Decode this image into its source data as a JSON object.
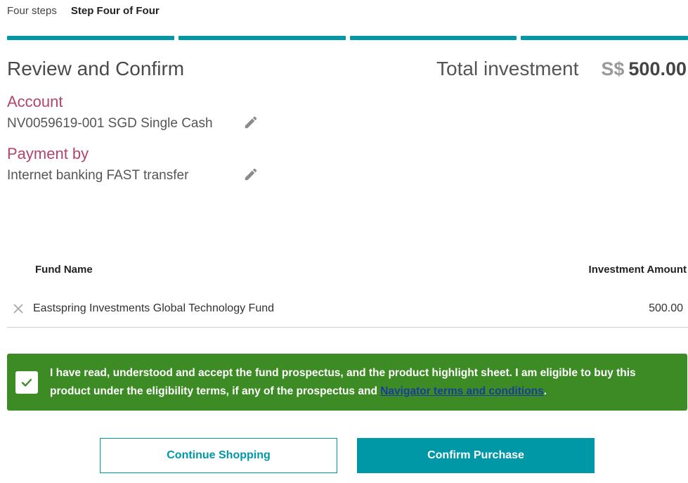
{
  "colors": {
    "accent": "#0097a7",
    "section_label": "#b0456e",
    "consent_bg": "#3d8b25",
    "link": "#1a3c9a"
  },
  "steps": {
    "label": "Four steps",
    "current": "Step Four of Four",
    "total_steps": 4,
    "completed_steps": 4
  },
  "review": {
    "title": "Review and Confirm",
    "total_label": "Total investment",
    "currency": "S$",
    "total_amount": "500.00"
  },
  "account": {
    "label": "Account",
    "value": "NV0059619-001 SGD Single Cash",
    "edit_icon": "pencil-icon"
  },
  "payment": {
    "label": "Payment by",
    "value": "Internet banking FAST transfer",
    "edit_icon": "pencil-icon"
  },
  "table": {
    "col_fund_name": "Fund Name",
    "col_investment_amount": "Investment Amount",
    "rows": [
      {
        "fund_name": "Eastspring Investments Global Technology Fund",
        "amount": "500.00",
        "remove_icon": "close-icon"
      }
    ]
  },
  "consent": {
    "checked": true,
    "text_before": "I have read, understood and accept the fund prospectus, and the product highlight sheet. I am eligible to buy this product under the eligibility terms, if any of the prospectus and ",
    "link_text": "Navigator terms and conditions",
    "text_after": "."
  },
  "buttons": {
    "continue_shopping": "Continue Shopping",
    "confirm_purchase": "Confirm Purchase"
  }
}
